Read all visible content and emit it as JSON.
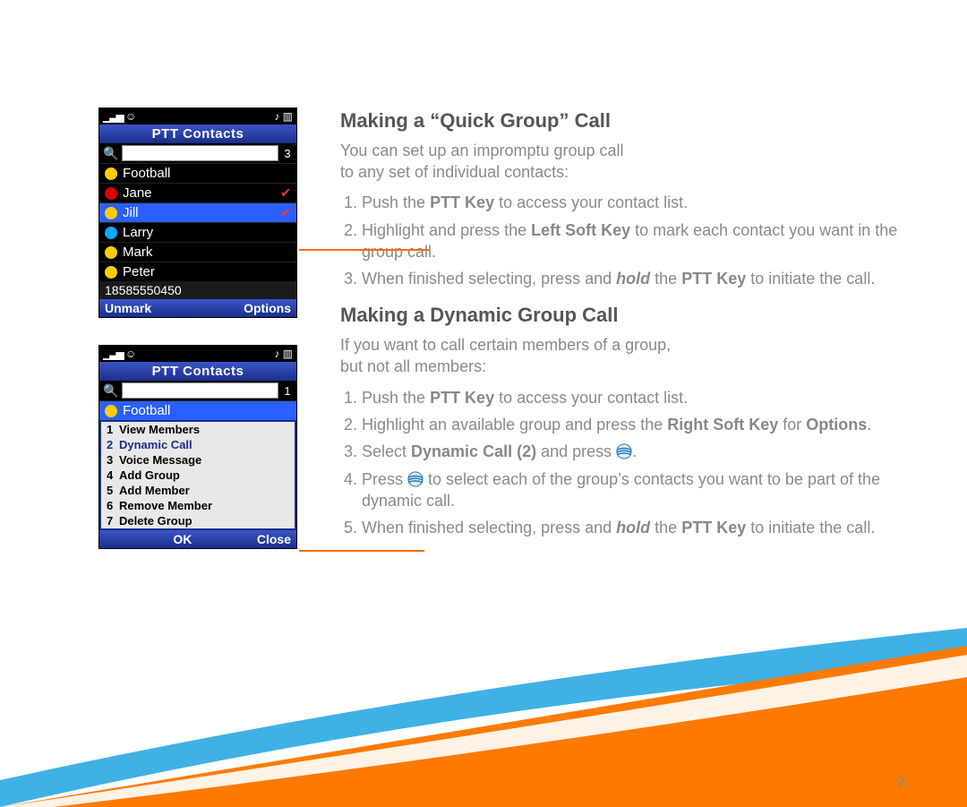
{
  "page_number": "9",
  "phone1": {
    "title": "PTT Contacts",
    "search_count": "3",
    "contacts": [
      {
        "name": "Football",
        "presence": "yellow",
        "checked": false
      },
      {
        "name": "Jane",
        "presence": "red",
        "checked": true
      },
      {
        "name": "Jill",
        "presence": "yellow",
        "checked": true,
        "selected": true
      },
      {
        "name": "Larry",
        "presence": "blue",
        "checked": false
      },
      {
        "name": "Mark",
        "presence": "yellow",
        "checked": false
      },
      {
        "name": "Peter",
        "presence": "yellow",
        "checked": false
      }
    ],
    "number": "18585550450",
    "soft_left": "Unmark",
    "soft_right": "Options"
  },
  "phone2": {
    "title": "PTT Contacts",
    "search_count": "1",
    "group": {
      "name": "Football",
      "presence": "yellow"
    },
    "menu": [
      {
        "n": "1",
        "label": "View Members"
      },
      {
        "n": "2",
        "label": "Dynamic Call",
        "selected": true
      },
      {
        "n": "3",
        "label": "Voice Message"
      },
      {
        "n": "4",
        "label": "Add Group"
      },
      {
        "n": "5",
        "label": "Add Member"
      },
      {
        "n": "6",
        "label": "Remove Member"
      },
      {
        "n": "7",
        "label": "Delete Group"
      }
    ],
    "soft_center": "OK",
    "soft_right": "Close"
  },
  "text": {
    "h1": "Making a “Quick Group” Call",
    "p1a": "You can set up an impromptu group call",
    "p1b": "to any set of individual contacts:",
    "s1_1a": "Push the ",
    "s1_1b": "PTT Key",
    "s1_1c": " to access your contact list.",
    "s1_2a": "Highlight and press the ",
    "s1_2b": "Left Soft Key",
    "s1_2c": " to mark each contact you want in the group call.",
    "s1_3a": "When finished selecting, press and ",
    "s1_3b": "hold",
    "s1_3c": " the ",
    "s1_3d": "PTT Key",
    "s1_3e": " to initiate the call.",
    "h2": "Making a Dynamic Group Call",
    "p2a": "If you want to call certain members of a group,",
    "p2b": "but not all members:",
    "s2_1a": "Push the ",
    "s2_1b": "PTT Key",
    "s2_1c": " to access your contact list.",
    "s2_2a": "Highlight an available group and press the ",
    "s2_2b": "Right Soft Key",
    "s2_2c": " for ",
    "s2_2d": "Options",
    "s2_2e": ".",
    "s2_3a": "Select ",
    "s2_3b": "Dynamic Call (2)",
    "s2_3c": " and press ",
    "s2_4a": "Press ",
    "s2_4b": " to select each of the group’s contacts you want to be part of the dynamic call.",
    "s2_5a": "When finished selecting, press and ",
    "s2_5b": "hold",
    "s2_5c": " the ",
    "s2_5d": "PTT Key",
    "s2_5e": " to initiate the call."
  }
}
